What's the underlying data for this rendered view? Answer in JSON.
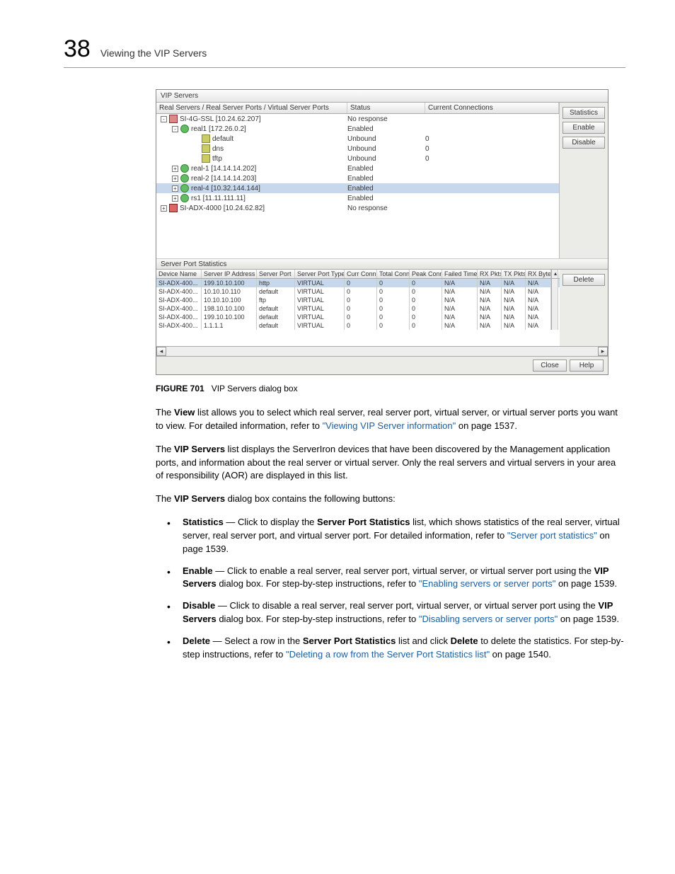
{
  "header": {
    "number": "38",
    "title": "Viewing the VIP Servers"
  },
  "dialog": {
    "title": "VIP Servers",
    "top_headers": {
      "tree": "Real Servers / Real Server Ports / Virtual Server Ports",
      "status": "Status",
      "conn": "Current Connections"
    },
    "side_buttons_top": [
      "Statistics",
      "Enable",
      "Disable"
    ],
    "tree": [
      {
        "indent": 0,
        "expander": "-",
        "icon": "server",
        "label": "SI-4G-SSL [10.24.62.207]",
        "status": "No response",
        "conn": ""
      },
      {
        "indent": 1,
        "expander": "-",
        "icon": "real",
        "label": "real1 [172.26.0.2]",
        "status": "Enabled",
        "conn": ""
      },
      {
        "indent": 2,
        "expander": "",
        "icon": "port",
        "label": "default",
        "status": "Unbound",
        "conn": "0"
      },
      {
        "indent": 2,
        "expander": "",
        "icon": "port",
        "label": "dns",
        "status": "Unbound",
        "conn": "0"
      },
      {
        "indent": 2,
        "expander": "",
        "icon": "port",
        "label": "tftp",
        "status": "Unbound",
        "conn": "0"
      },
      {
        "indent": 1,
        "expander": "+",
        "icon": "real",
        "label": "real-1 [14.14.14.202]",
        "status": "Enabled",
        "conn": ""
      },
      {
        "indent": 1,
        "expander": "+",
        "icon": "real",
        "label": "real-2 [14.14.14.203]",
        "status": "Enabled",
        "conn": ""
      },
      {
        "indent": 1,
        "expander": "+",
        "icon": "real",
        "label": "real-4 [10.32.144.144]",
        "status": "Enabled",
        "conn": "",
        "selected": true
      },
      {
        "indent": 1,
        "expander": "+",
        "icon": "real",
        "label": "rs1 [11.11.111.11]",
        "status": "Enabled",
        "conn": ""
      },
      {
        "indent": 0,
        "expander": "+",
        "icon": "adx",
        "label": "SI-ADX-4000 [10.24.62.82]",
        "status": "No response",
        "conn": ""
      }
    ],
    "stats_title": "Server Port Statistics",
    "stats_headers": [
      "Device Name",
      "Server IP Address",
      "Server Port",
      "Server Port Type",
      "Curr Conn",
      "Total Conn",
      "Peak Conn",
      "Failed Time",
      "RX Pkts",
      "TX Pkts",
      "RX Bytes"
    ],
    "stats_rows": [
      {
        "cells": [
          "SI-ADX-400...",
          "199.10.10.100",
          "http",
          "VIRTUAL",
          "0",
          "0",
          "0",
          "N/A",
          "N/A",
          "N/A",
          "N/A"
        ],
        "selected": true
      },
      {
        "cells": [
          "SI-ADX-400...",
          "10.10.10.110",
          "default",
          "VIRTUAL",
          "0",
          "0",
          "0",
          "N/A",
          "N/A",
          "N/A",
          "N/A"
        ]
      },
      {
        "cells": [
          "SI-ADX-400...",
          "10.10.10.100",
          "ftp",
          "VIRTUAL",
          "0",
          "0",
          "0",
          "N/A",
          "N/A",
          "N/A",
          "N/A"
        ]
      },
      {
        "cells": [
          "SI-ADX-400...",
          "198.10.10.100",
          "default",
          "VIRTUAL",
          "0",
          "0",
          "0",
          "N/A",
          "N/A",
          "N/A",
          "N/A"
        ]
      },
      {
        "cells": [
          "SI-ADX-400...",
          "199.10.10.100",
          "default",
          "VIRTUAL",
          "0",
          "0",
          "0",
          "N/A",
          "N/A",
          "N/A",
          "N/A"
        ]
      },
      {
        "cells": [
          "SI-ADX-400...",
          "1.1.1.1",
          "default",
          "VIRTUAL",
          "0",
          "0",
          "0",
          "N/A",
          "N/A",
          "N/A",
          "N/A"
        ]
      }
    ],
    "side_buttons_bottom": [
      "Delete"
    ],
    "footer_buttons": [
      "Close",
      "Help"
    ]
  },
  "caption": {
    "label": "FIGURE 701",
    "text": "VIP Servers dialog box"
  },
  "prose": {
    "p1_a": "The ",
    "p1_b": "View",
    "p1_c": " list allows you to select which real server, real server port, virtual server, or virtual server ports you want to view. For detailed information, refer to ",
    "p1_link": "\"Viewing VIP Server information\"",
    "p1_d": " on page 1537.",
    "p2_a": "The ",
    "p2_b": "VIP Servers",
    "p2_c": " list displays the ServerIron devices that have been discovered by the Management application ports, and information about the real server or virtual server. Only the real servers and virtual servers in your area of responsibility (AOR) are displayed in this list.",
    "p3_a": "The ",
    "p3_b": "VIP Servers",
    "p3_c": " dialog box contains the following buttons:"
  },
  "bullets": {
    "b1": {
      "bold": "Statistics",
      "a": " — Click to display the ",
      "bold2": "Server Port Statistics",
      "b": " list, which shows statistics of the real server, virtual server, real server port, and virtual server port. For detailed information, refer to ",
      "link": "\"Server port statistics\"",
      "c": " on page 1539."
    },
    "b2": {
      "bold": "Enable",
      "a": " — Click to enable a real server, real server port, virtual server, or virtual server port using the ",
      "bold2": "VIP Servers",
      "b": " dialog box. For step-by-step instructions, refer to ",
      "link": "\"Enabling servers or server ports\"",
      "c": " on page 1539."
    },
    "b3": {
      "bold": "Disable",
      "a": " — Click to disable a real server, real server port, virtual server, or virtual server port using the ",
      "bold2": "VIP Servers",
      "b": " dialog box. For step-by-step instructions, refer to ",
      "link": "\"Disabling servers or server ports\"",
      "c": " on page 1539."
    },
    "b4": {
      "bold": "Delete",
      "a": " — Select a row in the ",
      "bold2": "Server Port Statistics",
      "b": " list and click ",
      "bold3": "Delete",
      "c": " to delete the statistics. For step-by-step instructions, refer to ",
      "link": "\"Deleting a row from the Server Port Statistics list\"",
      "d": " on page 1540."
    }
  }
}
